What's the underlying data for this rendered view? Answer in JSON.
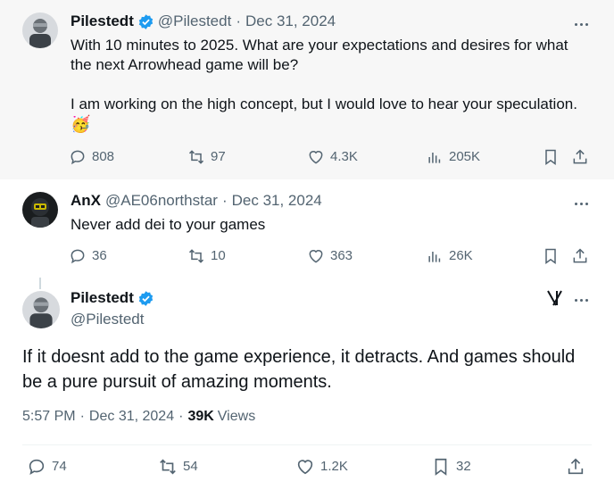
{
  "reply_to": {
    "name": "Pilestedt",
    "handle": "@Pilestedt",
    "separator": "·",
    "date": "Dec 31, 2024",
    "text_lines": [
      "With 10 minutes to 2025. What are your expectations and desires for what",
      "the next Arrowhead game will be?",
      "",
      "I am working on the high concept, but I would love to hear your speculation."
    ],
    "emoji": "🥳",
    "stats": {
      "replies": "808",
      "reposts": "97",
      "likes": "4.3K",
      "views": "205K"
    }
  },
  "reply": {
    "name": "AnX",
    "handle": "@AE06northstar",
    "separator": "·",
    "date": "Dec 31, 2024",
    "text": "Never add dei to your games",
    "stats": {
      "replies": "36",
      "reposts": "10",
      "likes": "363",
      "views": "26K"
    }
  },
  "main": {
    "name": "Pilestedt",
    "handle": "@Pilestedt",
    "text_lines": [
      "If it doesnt add to the game experience, it detracts. And games should",
      "be a pure pursuit of amazing moments."
    ],
    "time": "5:57 PM",
    "separator": "·",
    "date": "Dec 31, 2024",
    "views_count": "39K",
    "views_label": "Views",
    "stats": {
      "replies": "74",
      "reposts": "54",
      "likes": "1.2K",
      "bookmarks": "32"
    }
  },
  "colors": {
    "verified": "#1d9bf0",
    "muted": "#536471",
    "text": "#0f1419",
    "highlight_bg": "#f7f7f7"
  }
}
